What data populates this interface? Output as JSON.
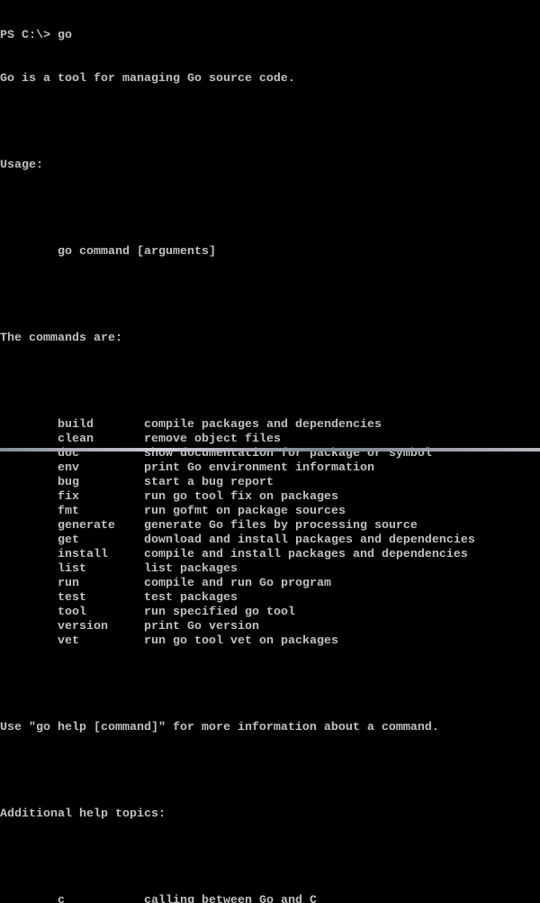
{
  "terminal": {
    "prompt": "PS C:\\> go",
    "intro": "Go is a tool for managing Go source code.",
    "usage_label": "Usage:",
    "usage_cmd": "go command [arguments]",
    "commands_heading": "The commands are:",
    "commands": [
      {
        "name": "build",
        "desc": "compile packages and dependencies"
      },
      {
        "name": "clean",
        "desc": "remove object files"
      },
      {
        "name": "doc",
        "desc": "show documentation for package or symbol"
      },
      {
        "name": "env",
        "desc": "print Go environment information"
      },
      {
        "name": "bug",
        "desc": "start a bug report"
      },
      {
        "name": "fix",
        "desc": "run go tool fix on packages"
      },
      {
        "name": "fmt",
        "desc": "run gofmt on package sources"
      },
      {
        "name": "generate",
        "desc": "generate Go files by processing source"
      },
      {
        "name": "get",
        "desc": "download and install packages and dependencies"
      },
      {
        "name": "install",
        "desc": "compile and install packages and dependencies"
      },
      {
        "name": "list",
        "desc": "list packages"
      },
      {
        "name": "run",
        "desc": "compile and run Go program"
      },
      {
        "name": "test",
        "desc": "test packages"
      },
      {
        "name": "tool",
        "desc": "run specified go tool"
      },
      {
        "name": "version",
        "desc": "print Go version"
      },
      {
        "name": "vet",
        "desc": "run go tool vet on packages"
      }
    ],
    "help_hint": "Use \"go help [command]\" for more information about a command.",
    "topics_heading": "Additional help topics:",
    "topics": [
      {
        "name": "c",
        "desc": "calling between Go and C"
      }
    ]
  },
  "colors": {
    "background": "#000000",
    "text": "#c0c0c0"
  }
}
